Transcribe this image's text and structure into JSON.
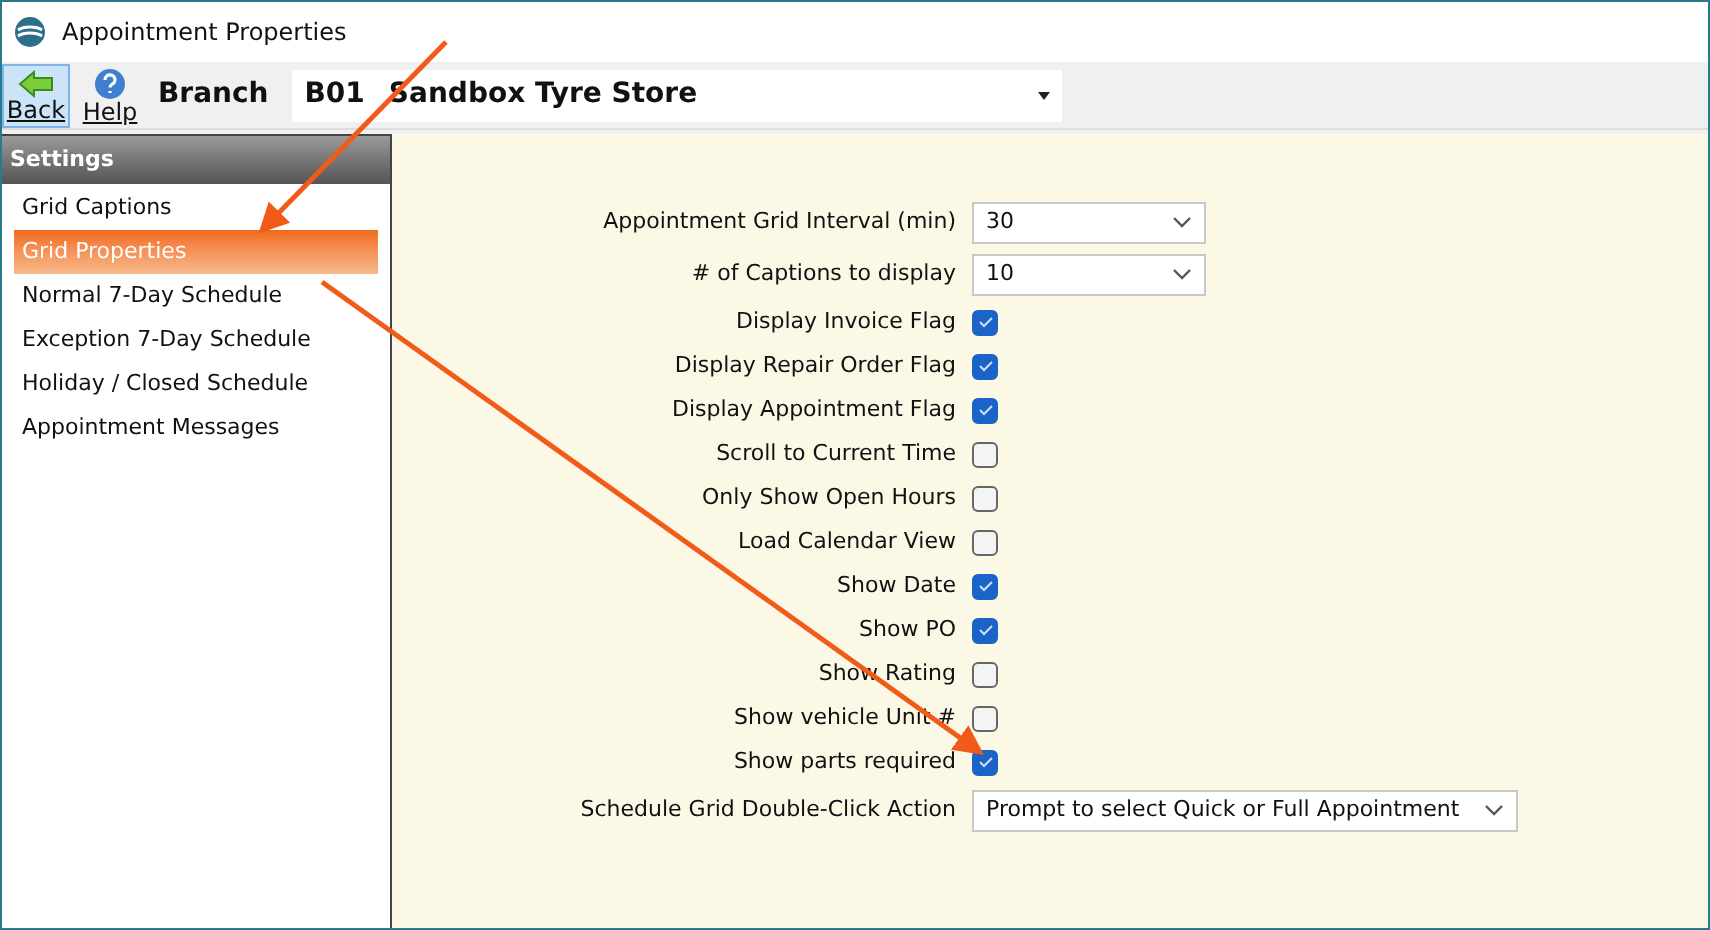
{
  "window": {
    "title": "Appointment Properties"
  },
  "toolbar": {
    "back": "Back",
    "help": "Help",
    "branch_label": "Branch",
    "branch_code": "B01",
    "branch_name": "Sandbox Tyre Store"
  },
  "sidebar": {
    "header": "Settings",
    "items": [
      {
        "label": "Grid Captions",
        "selected": false
      },
      {
        "label": "Grid Properties",
        "selected": true
      },
      {
        "label": "Normal 7-Day Schedule",
        "selected": false
      },
      {
        "label": "Exception 7-Day Schedule",
        "selected": false
      },
      {
        "label": "Holiday / Closed Schedule",
        "selected": false
      },
      {
        "label": "Appointment Messages",
        "selected": false
      }
    ]
  },
  "form": [
    {
      "kind": "select",
      "label": "Appointment Grid Interval (min)",
      "value": "30"
    },
    {
      "kind": "select",
      "label": "# of Captions to display",
      "value": "10"
    },
    {
      "kind": "checkbox",
      "label": "Display Invoice Flag",
      "checked": true
    },
    {
      "kind": "checkbox",
      "label": "Display Repair Order Flag",
      "checked": true
    },
    {
      "kind": "checkbox",
      "label": "Display Appointment Flag",
      "checked": true
    },
    {
      "kind": "checkbox",
      "label": "Scroll to Current Time",
      "checked": false
    },
    {
      "kind": "checkbox",
      "label": "Only Show Open Hours",
      "checked": false
    },
    {
      "kind": "checkbox",
      "label": "Load Calendar View",
      "checked": false
    },
    {
      "kind": "checkbox",
      "label": "Show Date",
      "checked": true
    },
    {
      "kind": "checkbox",
      "label": "Show PO",
      "checked": true
    },
    {
      "kind": "checkbox",
      "label": "Show Rating",
      "checked": false
    },
    {
      "kind": "checkbox",
      "label": "Show vehicle Unit #",
      "checked": false
    },
    {
      "kind": "checkbox",
      "label": "Show parts required",
      "checked": true
    },
    {
      "kind": "wide_select",
      "label": "Schedule Grid Double-Click Action",
      "value": "Prompt to select Quick or Full Appointment"
    }
  ]
}
